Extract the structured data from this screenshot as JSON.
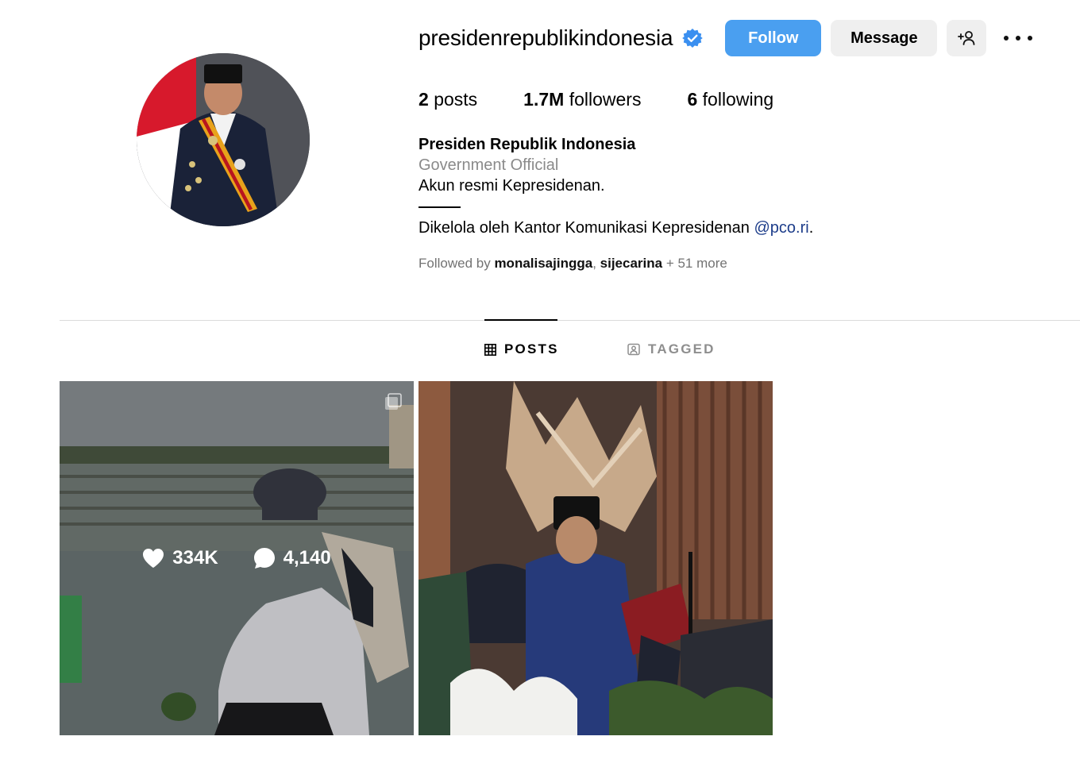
{
  "profile": {
    "username": "presidenrepublikindonesia",
    "verified": true,
    "accent_color": "#4a9ff0",
    "avatar_icon": "profile-photo",
    "actions": {
      "follow_label": "Follow",
      "message_label": "Message",
      "add_user_icon": "add-user-icon",
      "more_icon": "more-options-icon"
    }
  },
  "stats": {
    "posts_count": "2",
    "posts_label": "posts",
    "followers_count": "1.7M",
    "followers_label": "followers",
    "following_count": "6",
    "following_label": "following"
  },
  "bio": {
    "name": "Presiden Republik Indonesia",
    "category": "Government Official",
    "line1": "Akun resmi Kepresidenan.",
    "line2_text": "Dikelola oleh Kantor Komunikasi Kepresidenan ",
    "line2_mention": "@pco.ri",
    "line2_end": "."
  },
  "followed_by": {
    "prefix": "Followed by ",
    "user1": "monalisajingga",
    "separator": ", ",
    "user2": "sijecarina",
    "suffix": " + 51 more"
  },
  "tabs": [
    {
      "label": "POSTS",
      "icon": "grid-icon",
      "active": true
    },
    {
      "label": "TAGGED",
      "icon": "tagged-icon",
      "active": false
    }
  ],
  "posts": [
    {
      "likes": "334K",
      "comments": "4,140",
      "hover": true,
      "multi": true
    },
    {
      "hover": false,
      "multi": false
    }
  ]
}
